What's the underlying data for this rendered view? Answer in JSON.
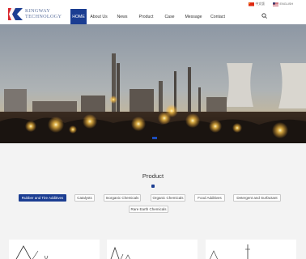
{
  "brand": {
    "line1": "KINGWAY",
    "line2": "TECHNOLOGY"
  },
  "nav": {
    "home": "HOME",
    "about": "About Us",
    "news": "News",
    "product": "Product",
    "case": "Case",
    "message": "Message",
    "contact": "Contact"
  },
  "language": {
    "chinese": "中文版",
    "english": "ENGLISH"
  },
  "product": {
    "title": "Product",
    "categories": [
      "Rubber and Tire Additives",
      "Catalysts",
      "Inorganic Chemicals",
      "Organic Chemicals",
      "Food Additives",
      "Detergent and Surfactant",
      "Rare Earth Chemicals"
    ]
  },
  "colors": {
    "brand_blue": "#1b3d92",
    "brand_red": "#d9262c"
  },
  "icons": {
    "search": "search-icon"
  }
}
